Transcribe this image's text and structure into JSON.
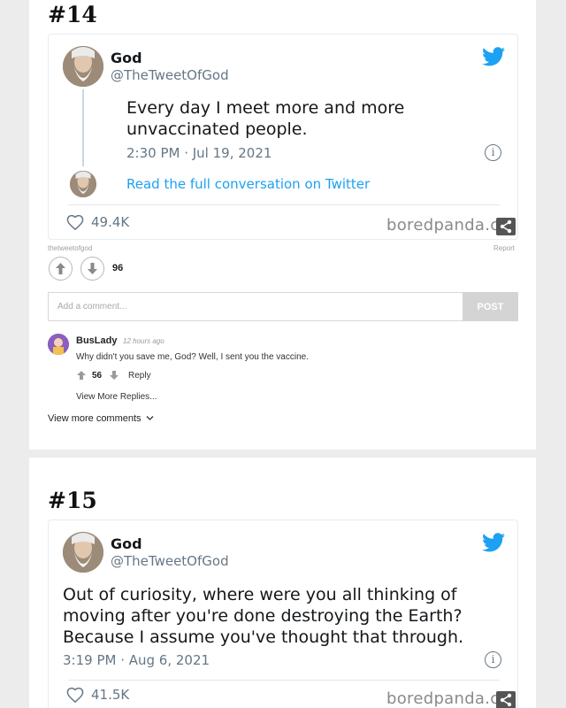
{
  "items": [
    {
      "number": "#14",
      "tweet": {
        "name": "God",
        "handle": "@TheTweetOfGod",
        "text_lines": [
          "Every day I meet more and more",
          "unvaccinated people."
        ],
        "time": "2:30 PM · Jul 19, 2021",
        "read_link": "Read the full conversation on Twitter",
        "likes": "49.4K",
        "watermark": "boredpanda.co"
      },
      "source": "thetweetofgod",
      "report_label": "Report",
      "vote_count": "96",
      "comment_placeholder": "Add a comment...",
      "post_label": "POST",
      "comment": {
        "user": "BusLady",
        "time": "12 hours ago",
        "text": "Why didn't you save me, God? Well, I sent you the vaccine.",
        "votes": "56",
        "reply_label": "Reply",
        "view_replies": "View More Replies..."
      },
      "view_more_comments": "View more comments"
    },
    {
      "number": "#15",
      "tweet": {
        "name": "God",
        "handle": "@TheTweetOfGod",
        "text_lines": [
          "Out of curiosity, where were you all thinking of",
          "moving after you're done destroying the Earth?",
          "Because I assume you've thought that through."
        ],
        "time": "3:19 PM · Aug 6, 2021",
        "likes": "41.5K",
        "watermark": "boredpanda.co"
      }
    }
  ],
  "colors": {
    "twitter_blue": "#1da1f2",
    "muted_text": "#657786",
    "page_bg": "#ececec"
  },
  "icons": [
    "twitter-bird-icon",
    "info-icon",
    "heart-icon",
    "share-icon",
    "upvote-icon",
    "downvote-icon",
    "chevron-down-icon"
  ]
}
